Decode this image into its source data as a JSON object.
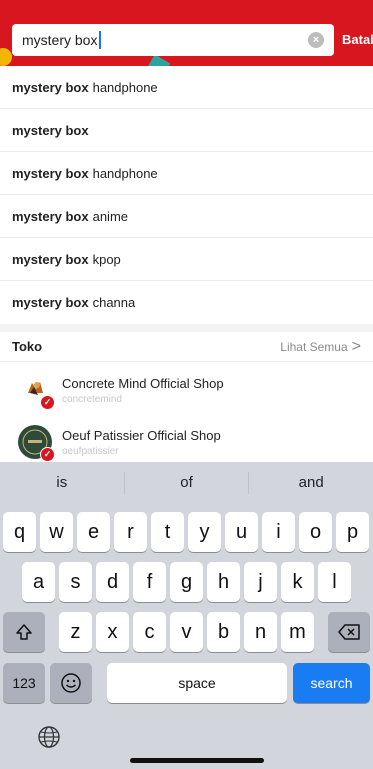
{
  "search": {
    "value": "mystery box",
    "clear_icon": "clear-circle-icon",
    "cancel_label": "Batal"
  },
  "suggestions": [
    {
      "bold": "mystery box",
      "rest": "handphone"
    },
    {
      "bold": "mystery box",
      "rest": ""
    },
    {
      "bold": "mystery box",
      "rest": "handphone"
    },
    {
      "bold": "mystery box",
      "rest": "anime"
    },
    {
      "bold": "mystery box",
      "rest": "kpop"
    },
    {
      "bold": "mystery box",
      "rest": "channa"
    }
  ],
  "stores": {
    "title": "Toko",
    "see_all": "Lihat Semua",
    "items": [
      {
        "name": "Concrete Mind Official Shop",
        "handle": "concretemind"
      },
      {
        "name": "Oeuf Patissier Official Shop",
        "handle": "oeufpatissier"
      }
    ],
    "official_badge_color": "#d8161f"
  },
  "keyboard": {
    "predictions": [
      "is",
      "of",
      "and"
    ],
    "row1": [
      "q",
      "w",
      "e",
      "r",
      "t",
      "y",
      "u",
      "i",
      "o",
      "p"
    ],
    "row2": [
      "a",
      "s",
      "d",
      "f",
      "g",
      "h",
      "j",
      "k",
      "l"
    ],
    "row3": [
      "z",
      "x",
      "c",
      "v",
      "b",
      "n",
      "m"
    ],
    "numbers_label": "123",
    "space_label": "space",
    "search_label": "search"
  },
  "colors": {
    "brand": "#d8161f",
    "search_key": "#1a7cf3"
  }
}
